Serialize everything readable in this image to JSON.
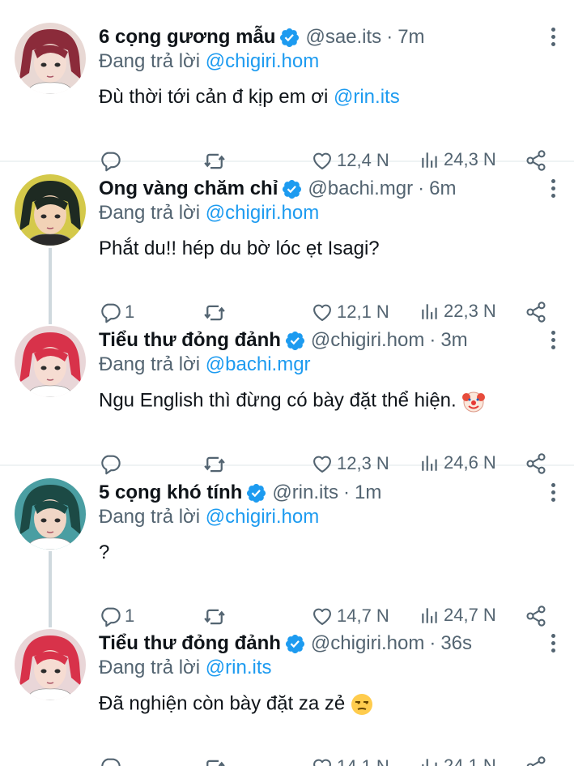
{
  "tweets": [
    {
      "name": "6 cọng gương mẫu",
      "handle": "@sae.its",
      "time": "7m",
      "reply_prefix": "Đang trả lời ",
      "reply_to": "@chigiri.hom",
      "text": "Đù thời tới cản đ kịp em ơi ",
      "text_mention": "@rin.its",
      "reply_count": "",
      "likes": "12,4 N",
      "views": "24,3 N",
      "avatar_colors": {
        "bg": "#e8d8d4",
        "hair": "#8b2b3a",
        "skin": "#f4ddd3"
      }
    },
    {
      "name": "Ong vàng chăm chỉ",
      "handle": "@bachi.mgr",
      "time": "6m",
      "reply_prefix": "Đang trả lời ",
      "reply_to": "@chigiri.hom",
      "text": "Phắt du!! hép du bờ lóc ẹt Isagi?",
      "reply_count": "1",
      "likes": "12,1 N",
      "views": "22,3 N",
      "avatar_colors": {
        "bg": "#d4c94a",
        "hair": "#1e2a22",
        "skin": "#f2d2b6"
      }
    },
    {
      "name": "Tiểu thư đỏng đảnh",
      "handle": "@chigiri.hom",
      "time": "3m",
      "reply_prefix": "Đang trả lời ",
      "reply_to": "@bachi.mgr",
      "text": "Ngu English thì đừng có bày đặt thể hiện.",
      "emoji": "clown-face",
      "reply_count": "",
      "likes": "12,3 N",
      "views": "24,6 N",
      "avatar_colors": {
        "bg": "#e9d6d8",
        "hair": "#d8324a",
        "skin": "#f6dcd2"
      }
    },
    {
      "name": "5 cọng khó tính",
      "handle": "@rin.its",
      "time": "1m",
      "reply_prefix": "Đang trả lời ",
      "reply_to": "@chigiri.hom",
      "text": "?",
      "reply_count": "1",
      "likes": "14,7 N",
      "views": "24,7 N",
      "avatar_colors": {
        "bg": "#4a9ea2",
        "hair": "#1c4a45",
        "skin": "#f0d6c6"
      }
    },
    {
      "name": "Tiểu thư đỏng đảnh",
      "handle": "@chigiri.hom",
      "time": "36s",
      "reply_prefix": "Đang trả lời ",
      "reply_to": "@rin.its",
      "text": "Đã nghiện còn bày đặt za zẻ",
      "emoji": "unamused-face",
      "reply_count": "",
      "likes": "14,1 N",
      "views": "24,1 N",
      "avatar_colors": {
        "bg": "#e9d6d8",
        "hair": "#d8324a",
        "skin": "#f6dcd2"
      }
    }
  ],
  "colors": {
    "accent": "#1d9bf0",
    "muted": "#536471",
    "text": "#0f1419",
    "thread": "#cfd9de"
  },
  "icons": [
    "verified-badge-icon",
    "more-icon",
    "reply-icon",
    "retweet-icon",
    "like-icon",
    "views-icon",
    "share-icon"
  ]
}
